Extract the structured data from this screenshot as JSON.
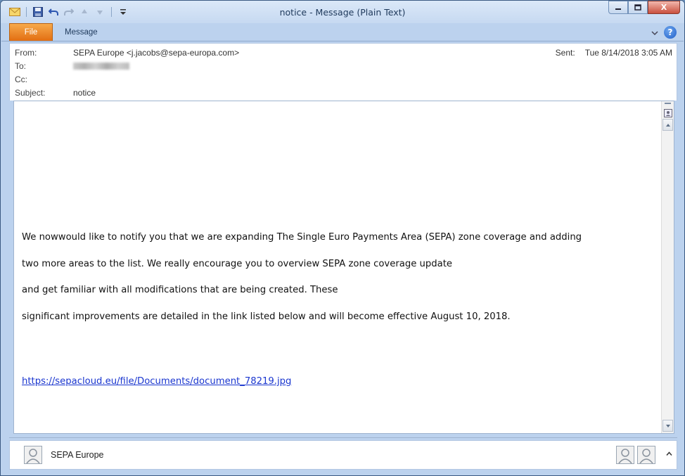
{
  "window": {
    "title": "notice  -  Message (Plain Text)",
    "controls": {
      "minimize": "—",
      "maximize": "□",
      "close": "X"
    }
  },
  "ribbon": {
    "tabs": [
      {
        "label": "File"
      },
      {
        "label": "Message"
      }
    ],
    "help": "?"
  },
  "header": {
    "from_label": "From:",
    "from_value": "SEPA Europe <j.jacobs@sepa-europa.com>",
    "to_label": "To:",
    "cc_label": "Cc:",
    "subject_label": "Subject:",
    "subject_value": "notice",
    "sent_label": "Sent:",
    "sent_value": "Tue 8/14/2018 3:05 AM"
  },
  "body": {
    "lines": [
      "We nowwould like to notify you that we are expanding The Single Euro Payments Area (SEPA) zone coverage and adding",
      "two more areas to the list.  We really encourage you to overview SEPA zone coverage update",
      "and get familiar with all modifications that are being created. These",
      "significant improvements are detailed in the link listed below and will become effective August 10, 2018."
    ],
    "link": "https://sepacloud.eu/file/Documents/document_78219.jpg"
  },
  "people_pane": {
    "name": "SEPA Europe"
  },
  "colors": {
    "file_tab": "#e26e12",
    "link": "#1a36cf",
    "frame": "#bcd2ee"
  }
}
